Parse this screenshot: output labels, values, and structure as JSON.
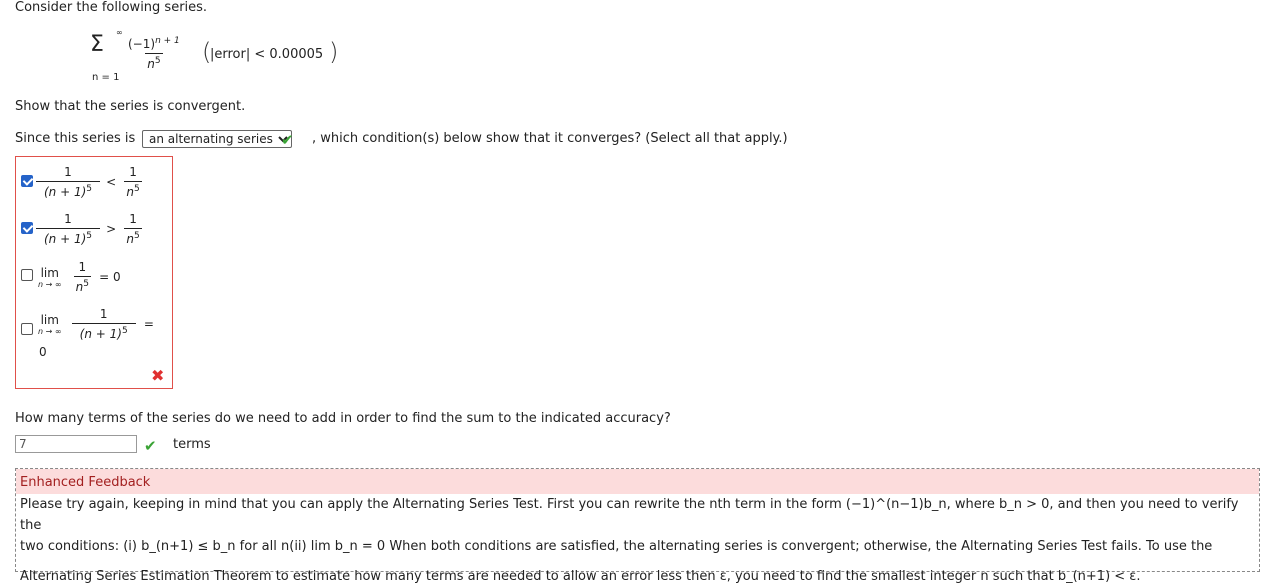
{
  "intro": "Consider the following series.",
  "series": {
    "sum_top": "∞",
    "sum_bottom": "n = 1",
    "numerator": "(−1)",
    "numerator_exp": "n + 1",
    "denominator": "n",
    "denominator_exp": "5",
    "accuracy_open": "(",
    "accuracy_text": "|error| < 0.00005",
    "accuracy_close": ")"
  },
  "prompt_convergent": "Show that the series is convergent.",
  "since_prefix": "Since this series is",
  "series_type_select": {
    "selected": "an alternating series",
    "options": [
      "an alternating series"
    ]
  },
  "since_suffix": ", which condition(s) below show that it converges? (Select all that apply.)",
  "conditions": [
    {
      "checked": true,
      "lhs_num": "1",
      "lhs_den": "(n + 1)",
      "lhs_exp": "5",
      "op": "<",
      "rhs_num": "1",
      "rhs_den": "n",
      "rhs_exp": "5"
    },
    {
      "checked": true,
      "lhs_num": "1",
      "lhs_den": "(n + 1)",
      "lhs_exp": "5",
      "op": ">",
      "rhs_num": "1",
      "rhs_den": "n",
      "rhs_exp": "5"
    },
    {
      "checked": false,
      "lim": "lim",
      "lim_sub": "n → ∞",
      "num": "1",
      "den": "n",
      "exp": "5",
      "eq": "= 0"
    },
    {
      "checked": false,
      "lim": "lim",
      "lim_sub": "n → ∞",
      "num": "1",
      "den": "(n + 1)",
      "exp": "5",
      "eq": "=",
      "value": "0"
    }
  ],
  "terms_question": "How many terms of the series do we need to add in order to find the sum to the indicated accuracy?",
  "terms_answer": "7",
  "terms_unit": "terms",
  "feedback": {
    "title": "Enhanced Feedback",
    "line1": "Please try again, keeping in mind that you can apply the Alternating Series Test. First you can rewrite the nth term in the form (−1)^(n−1)b_n, where b_n > 0, and then you need to verify the",
    "line2": "two conditions: (i) b_(n+1) ≤ b_n for all n(ii)  lim  b_n = 0 When both conditions are satisfied, the alternating series is convergent; otherwise, the Alternating Series Test fails. To use the",
    "line3": "Alternating Series Estimation Theorem to estimate how many terms are needed to allow an error less then ε, you need to find the smallest integer n such that b_(n+1) < ε."
  },
  "colors": {
    "correct": "#3aa335",
    "incorrect": "#e03030",
    "checkbox": "#2563c9",
    "feedback_bg": "#fcdcdc"
  }
}
